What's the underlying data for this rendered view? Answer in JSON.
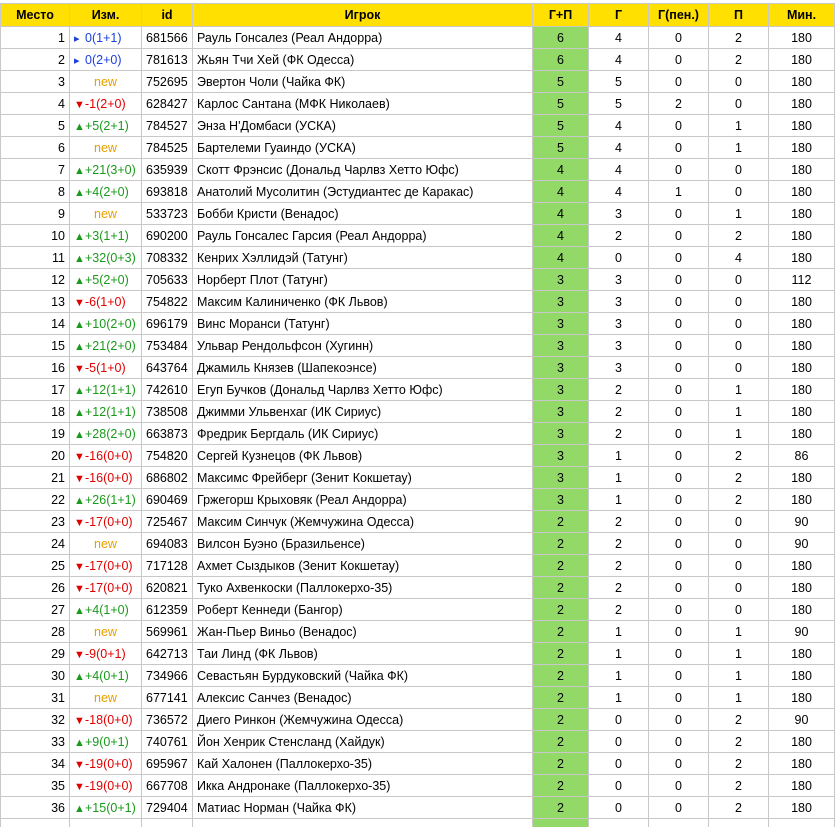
{
  "headers": {
    "place": "Место",
    "change": "Изм.",
    "id": "id",
    "player": "Игрок",
    "gp": "Г+П",
    "goals": "Г",
    "pen": "Г(пен.)",
    "assists": "П",
    "mins": "Мин."
  },
  "colors": {
    "header_bg": "#ffe000",
    "gp_bg": "#92d968",
    "up": "#1a9a1a",
    "down": "#e00000",
    "same": "#1a3fe0",
    "new": "#e6a000"
  },
  "rows": [
    {
      "place": "1",
      "dir": "same",
      "change": "0(1+1)",
      "id": "681566",
      "player": "Рауль Гонсалез (Реал Андорра)",
      "gp": "6",
      "g": "4",
      "pen": "0",
      "a": "2",
      "mins": "180"
    },
    {
      "place": "2",
      "dir": "same",
      "change": "0(2+0)",
      "id": "781613",
      "player": "Жьян Тчи Хей (ФК Одесса)",
      "gp": "6",
      "g": "4",
      "pen": "0",
      "a": "2",
      "mins": "180"
    },
    {
      "place": "3",
      "dir": "new",
      "change": "new",
      "id": "752695",
      "player": "Эвертон Чоли (Чайка ФК)",
      "gp": "5",
      "g": "5",
      "pen": "0",
      "a": "0",
      "mins": "180"
    },
    {
      "place": "4",
      "dir": "down",
      "change": "-1(2+0)",
      "id": "628427",
      "player": "Карлос Сантана (МФК Николаев)",
      "gp": "5",
      "g": "5",
      "pen": "2",
      "a": "0",
      "mins": "180"
    },
    {
      "place": "5",
      "dir": "up",
      "change": "+5(2+1)",
      "id": "784527",
      "player": "Энза Н'Домбаси (УСКА)",
      "gp": "5",
      "g": "4",
      "pen": "0",
      "a": "1",
      "mins": "180"
    },
    {
      "place": "6",
      "dir": "new",
      "change": "new",
      "id": "784525",
      "player": "Бартелеми Гуаиндо (УСКА)",
      "gp": "5",
      "g": "4",
      "pen": "0",
      "a": "1",
      "mins": "180"
    },
    {
      "place": "7",
      "dir": "up",
      "change": "+21(3+0)",
      "id": "635939",
      "player": "Скотт Фрэнсис (Дональд Чарлвз Хетто Юфс)",
      "gp": "4",
      "g": "4",
      "pen": "0",
      "a": "0",
      "mins": "180"
    },
    {
      "place": "8",
      "dir": "up",
      "change": "+4(2+0)",
      "id": "693818",
      "player": "Анатолий Мусолитин (Эстудиантес де Каракас)",
      "gp": "4",
      "g": "4",
      "pen": "1",
      "a": "0",
      "mins": "180"
    },
    {
      "place": "9",
      "dir": "new",
      "change": "new",
      "id": "533723",
      "player": "Бобби Кристи (Венадос)",
      "gp": "4",
      "g": "3",
      "pen": "0",
      "a": "1",
      "mins": "180"
    },
    {
      "place": "10",
      "dir": "up",
      "change": "+3(1+1)",
      "id": "690200",
      "player": "Рауль Гонсалес Гарсия (Реал Андорра)",
      "gp": "4",
      "g": "2",
      "pen": "0",
      "a": "2",
      "mins": "180"
    },
    {
      "place": "11",
      "dir": "up",
      "change": "+32(0+3)",
      "id": "708332",
      "player": "Кенрих Хэллидэй (Татунг)",
      "gp": "4",
      "g": "0",
      "pen": "0",
      "a": "4",
      "mins": "180"
    },
    {
      "place": "12",
      "dir": "up",
      "change": "+5(2+0)",
      "id": "705633",
      "player": "Норберт Плот (Татунг)",
      "gp": "3",
      "g": "3",
      "pen": "0",
      "a": "0",
      "mins": "112"
    },
    {
      "place": "13",
      "dir": "down",
      "change": "-6(1+0)",
      "id": "754822",
      "player": "Максим Калиниченко (ФК Львов)",
      "gp": "3",
      "g": "3",
      "pen": "0",
      "a": "0",
      "mins": "180"
    },
    {
      "place": "14",
      "dir": "up",
      "change": "+10(2+0)",
      "id": "696179",
      "player": "Винс Моранси (Татунг)",
      "gp": "3",
      "g": "3",
      "pen": "0",
      "a": "0",
      "mins": "180"
    },
    {
      "place": "15",
      "dir": "up",
      "change": "+21(2+0)",
      "id": "753484",
      "player": "Ульвар Рендольфсон (Хугинн)",
      "gp": "3",
      "g": "3",
      "pen": "0",
      "a": "0",
      "mins": "180"
    },
    {
      "place": "16",
      "dir": "down",
      "change": "-5(1+0)",
      "id": "643764",
      "player": "Джамиль Князев (Шапекоэнсе)",
      "gp": "3",
      "g": "3",
      "pen": "0",
      "a": "0",
      "mins": "180"
    },
    {
      "place": "17",
      "dir": "up",
      "change": "+12(1+1)",
      "id": "742610",
      "player": "Егуп Бучков (Дональд Чарлвз Хетто Юфс)",
      "gp": "3",
      "g": "2",
      "pen": "0",
      "a": "1",
      "mins": "180"
    },
    {
      "place": "18",
      "dir": "up",
      "change": "+12(1+1)",
      "id": "738508",
      "player": "Джимми Ульвенхаг (ИК Сириус)",
      "gp": "3",
      "g": "2",
      "pen": "0",
      "a": "1",
      "mins": "180"
    },
    {
      "place": "19",
      "dir": "up",
      "change": "+28(2+0)",
      "id": "663873",
      "player": "Фредрик Бергдаль (ИК Сириус)",
      "gp": "3",
      "g": "2",
      "pen": "0",
      "a": "1",
      "mins": "180"
    },
    {
      "place": "20",
      "dir": "down",
      "change": "-16(0+0)",
      "id": "754820",
      "player": "Сергей Кузнецов (ФК Львов)",
      "gp": "3",
      "g": "1",
      "pen": "0",
      "a": "2",
      "mins": "86"
    },
    {
      "place": "21",
      "dir": "down",
      "change": "-16(0+0)",
      "id": "686802",
      "player": "Максимс Фрейберг (Зенит Кокшетау)",
      "gp": "3",
      "g": "1",
      "pen": "0",
      "a": "2",
      "mins": "180"
    },
    {
      "place": "22",
      "dir": "up",
      "change": "+26(1+1)",
      "id": "690469",
      "player": "Гржегорш Крыховяк (Реал Андорра)",
      "gp": "3",
      "g": "1",
      "pen": "0",
      "a": "2",
      "mins": "180"
    },
    {
      "place": "23",
      "dir": "down",
      "change": "-17(0+0)",
      "id": "725467",
      "player": "Максим Синчук (Жемчужина Одесса)",
      "gp": "2",
      "g": "2",
      "pen": "0",
      "a": "0",
      "mins": "90"
    },
    {
      "place": "24",
      "dir": "new",
      "change": "new",
      "id": "694083",
      "player": "Вилсон Буэно (Бразильенсе)",
      "gp": "2",
      "g": "2",
      "pen": "0",
      "a": "0",
      "mins": "90"
    },
    {
      "place": "25",
      "dir": "down",
      "change": "-17(0+0)",
      "id": "717128",
      "player": "Ахмет Сыздыков (Зенит Кокшетау)",
      "gp": "2",
      "g": "2",
      "pen": "0",
      "a": "0",
      "mins": "180"
    },
    {
      "place": "26",
      "dir": "down",
      "change": "-17(0+0)",
      "id": "620821",
      "player": "Туко Ахвенкоски (Паллокерхо-35)",
      "gp": "2",
      "g": "2",
      "pen": "0",
      "a": "0",
      "mins": "180"
    },
    {
      "place": "27",
      "dir": "up",
      "change": "+4(1+0)",
      "id": "612359",
      "player": "Роберт Кеннеди (Бангор)",
      "gp": "2",
      "g": "2",
      "pen": "0",
      "a": "0",
      "mins": "180"
    },
    {
      "place": "28",
      "dir": "new",
      "change": "new",
      "id": "569961",
      "player": "Жан-Пьер Виньо (Венадос)",
      "gp": "2",
      "g": "1",
      "pen": "0",
      "a": "1",
      "mins": "90"
    },
    {
      "place": "29",
      "dir": "down",
      "change": "-9(0+1)",
      "id": "642713",
      "player": "Таи Линд (ФК Львов)",
      "gp": "2",
      "g": "1",
      "pen": "0",
      "a": "1",
      "mins": "180"
    },
    {
      "place": "30",
      "dir": "up",
      "change": "+4(0+1)",
      "id": "734966",
      "player": "Севастьян Бурдуковский (Чайка ФК)",
      "gp": "2",
      "g": "1",
      "pen": "0",
      "a": "1",
      "mins": "180"
    },
    {
      "place": "31",
      "dir": "new",
      "change": "new",
      "id": "677141",
      "player": "Алексис Санчез (Венадос)",
      "gp": "2",
      "g": "1",
      "pen": "0",
      "a": "1",
      "mins": "180"
    },
    {
      "place": "32",
      "dir": "down",
      "change": "-18(0+0)",
      "id": "736572",
      "player": "Диего Ринкон (Жемчужина Одесса)",
      "gp": "2",
      "g": "0",
      "pen": "0",
      "a": "2",
      "mins": "90"
    },
    {
      "place": "33",
      "dir": "up",
      "change": "+9(0+1)",
      "id": "740761",
      "player": "Йон Хенрик Стенсланд (Хайдук)",
      "gp": "2",
      "g": "0",
      "pen": "0",
      "a": "2",
      "mins": "180"
    },
    {
      "place": "34",
      "dir": "down",
      "change": "-19(0+0)",
      "id": "695967",
      "player": "Кай Халонен (Паллокерхо-35)",
      "gp": "2",
      "g": "0",
      "pen": "0",
      "a": "2",
      "mins": "180"
    },
    {
      "place": "35",
      "dir": "down",
      "change": "-19(0+0)",
      "id": "667708",
      "player": "Икка Андронаке (Паллокерхо-35)",
      "gp": "2",
      "g": "0",
      "pen": "0",
      "a": "2",
      "mins": "180"
    },
    {
      "place": "36",
      "dir": "up",
      "change": "+15(0+1)",
      "id": "729404",
      "player": "Матиас Норман (Чайка ФК)",
      "gp": "2",
      "g": "0",
      "pen": "0",
      "a": "2",
      "mins": "180"
    }
  ]
}
